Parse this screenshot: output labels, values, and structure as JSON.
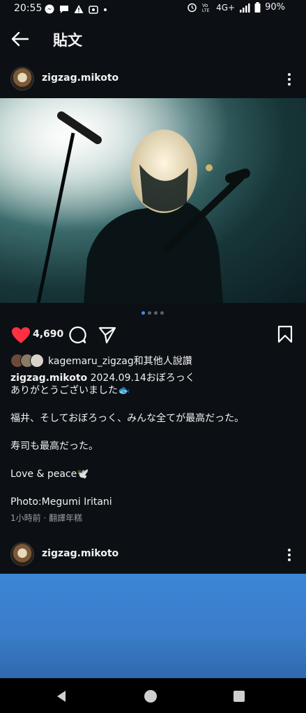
{
  "status_bar": {
    "time": "20:55",
    "network": "4G+",
    "battery": "90%"
  },
  "header": {
    "title": "貼文",
    "back_icon": "arrow-left-icon"
  },
  "post": {
    "username": "zigzag.mikoto",
    "like_count": "4,690",
    "liked_by": "kagemaru_zigzag和其他人說讚",
    "caption_user": "zigzag.mikoto",
    "caption_first": " 2024.09.14おぼろっく",
    "caption_lines": [
      "ありがとうございました🐟",
      "福井、そしておぼろっく、みんな全てが最高だった。",
      "寿司も最高だった。",
      "Love & peace🕊️",
      "Photo:Megumi Iritani"
    ],
    "time_ago": "1小時前",
    "translate_label": "翻譯年糕",
    "pager_total": 4,
    "pager_active": 1
  },
  "next_post": {
    "username": "zigzag.mikoto"
  },
  "colors": {
    "background": "#0c1015",
    "heart": "#ff3040",
    "pager_active": "#3b8cf0"
  }
}
